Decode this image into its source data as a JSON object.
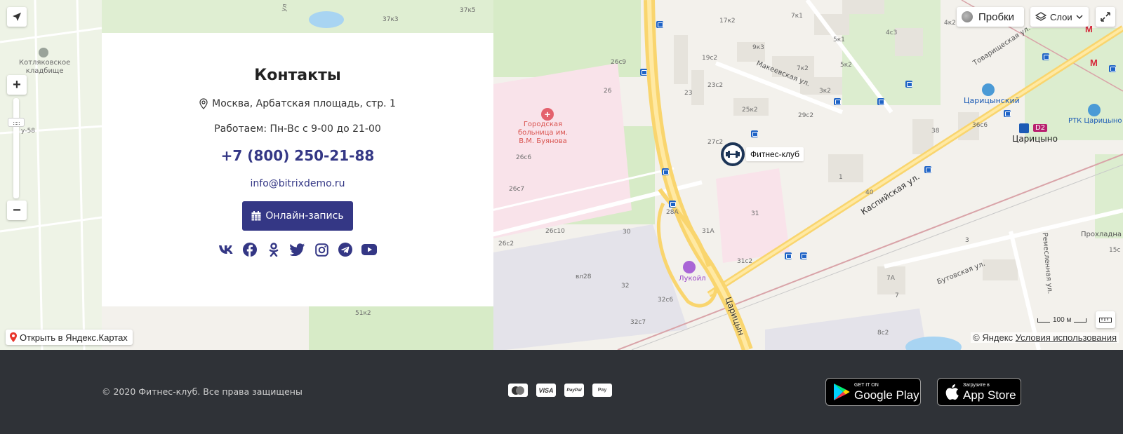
{
  "map": {
    "open_link_label": "Открыть в Яндекс.Картах",
    "copyright": "© Яндекс",
    "terms_link": "Условия использования",
    "scale_label": "100 м",
    "traffic_label": "Пробки",
    "layers_label": "Слои",
    "marker_label": "Фитнес-клуб",
    "labels": {
      "cemetery": "Котляковское\nкладбище",
      "hospital": "Городская\nбольница им.\nВ.М. Буянова",
      "lukoil": "Лукойл",
      "tsaritsynsky": "Царицынский",
      "rtk": "РТК Царицыно",
      "tsaritsyno": "Царицыно",
      "d2": "D2",
      "makeevskaya": "Макеевская ул.",
      "kaspiyskaya": "Каспийская ул.",
      "butovskaya": "Бутовская ул.",
      "tovarishcheskaya": "Товарищеская ул.",
      "remesennaya": "Ремесленная ул.",
      "prokhladnaya": "Прохладна",
      "tsaritsyno_street": "Царицын",
      "b_37k3": "37к3",
      "b_37k5": "37к5",
      "b_26s9": "26с9",
      "b_26": "26",
      "b_26s6": "26с6",
      "b_26s7": "26с7",
      "b_26s10": "26с10",
      "b_26s2": "26с2",
      "b_30": "30",
      "b_vl28": "вл28",
      "b_32": "32",
      "b_32s6": "32с6",
      "b_32s7": "32с7",
      "b_51k2": "51к2",
      "b_28A": "28А",
      "b_31A": "31А",
      "b_31": "31",
      "b_31s2": "31с2",
      "b_23": "23",
      "b_19s2": "19с2",
      "b_23s2": "23с2",
      "b_17k2": "17к2",
      "b_9k3": "9к3",
      "b_7k1": "7к1",
      "b_7k2": "7к2",
      "b_5k1": "5к1",
      "b_5k2": "5к2",
      "b_3k2": "3к2",
      "b_4s3": "4с3",
      "b_4k2": "4к2",
      "b_25k2": "25к2",
      "b_27s2": "27с2",
      "b_29s2": "29с2",
      "b_38": "38",
      "b_36s6": "36с6",
      "b_40": "40",
      "b_1": "1",
      "b_7A": "7А",
      "b_7": "7",
      "b_3": "3",
      "b_8s2": "8с2",
      "b_15s": "15с",
      "b_y58": "у-58",
      "b_ul": "ул"
    }
  },
  "contacts": {
    "title": "Контакты",
    "address": "Москва, Арбатская площадь, стр. 1",
    "hours": "Работаем: Пн-Вс с 9-00 до 21-00",
    "phone": "+7 (800) 250-21-88",
    "email": "info@bitrixdemo.ru",
    "book_button": "Онлайн-запись",
    "socials": [
      "vk-icon",
      "facebook-icon",
      "odnoklassniki-icon",
      "twitter-icon",
      "instagram-icon",
      "telegram-icon",
      "youtube-icon"
    ]
  },
  "footer": {
    "copyright": "© 2020 Фитнес-клуб. Все права защищены",
    "payments": [
      "MasterCard",
      "VISA",
      "PayPal",
      "Apple Pay"
    ],
    "visa_label": "VISA",
    "paypal_label": "PayPal",
    "applepay_label": "Pay",
    "google_play": {
      "small": "GET IT ON",
      "big": "Google Play"
    },
    "app_store": {
      "small": "Загрузите в",
      "big": "App Store"
    }
  },
  "colors": {
    "accent": "#343785",
    "footer_bg": "#2f3237",
    "map_bg": "#f3f1ec",
    "road_yellow": "#f9d56e"
  }
}
